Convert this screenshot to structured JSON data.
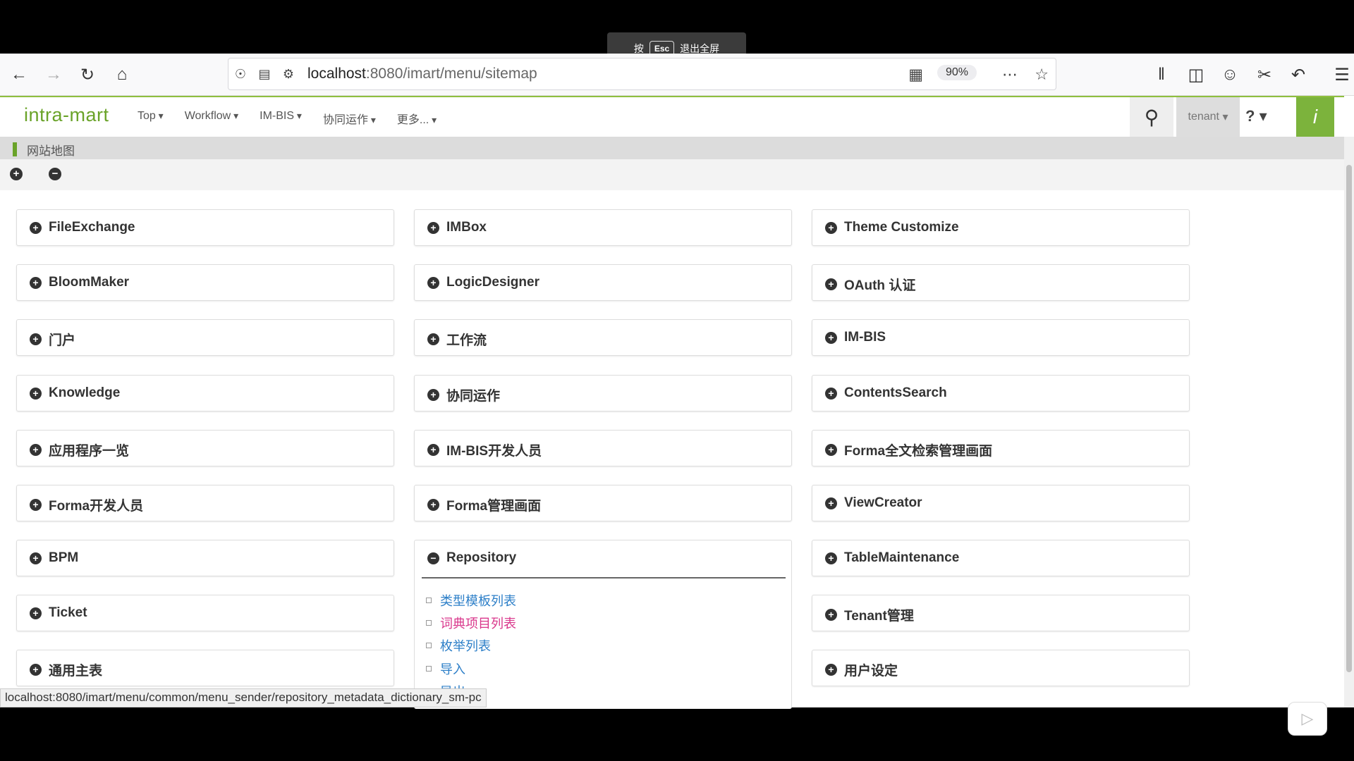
{
  "fullscreen_notice": {
    "press": "按",
    "key": "Esc",
    "exit": "退出全屏"
  },
  "browser": {
    "url_host": "localhost",
    "url_path": ":8080/imart/menu/sitemap",
    "zoom": "90%"
  },
  "app": {
    "logo": "intra-mart",
    "nav": [
      "Top",
      "Workflow",
      "IM-BIS",
      "协同运作",
      "更多..."
    ],
    "tenant": "tenant",
    "help": "?",
    "brand_icon": "i"
  },
  "breadcrumb": "网站地图",
  "actions": {
    "expand": "+",
    "collapse": "−"
  },
  "columns": [
    [
      "FileExchange",
      "BloomMaker",
      "门户",
      "Knowledge",
      "应用程序一览",
      "Forma开发人员",
      "BPM",
      "Ticket",
      "通用主表"
    ],
    [
      "IMBox",
      "LogicDesigner",
      "工作流",
      "协同运作",
      "IM-BIS开发人员",
      "Forma管理画面",
      "Repository"
    ],
    [
      "Theme Customize",
      "OAuth 认证",
      "IM-BIS",
      "ContentsSearch",
      "Forma全文检索管理画面",
      "ViewCreator",
      "TableMaintenance",
      "Tenant管理",
      "用户设定"
    ]
  ],
  "repository_items": [
    "类型模板列表",
    "词典项目列表",
    "枚举列表",
    "导入",
    "导出"
  ],
  "status_url": "localhost:8080/imart/menu/common/menu_sender/repository_metadata_dictionary_sm-pc",
  "colors": {
    "brand": "#7cb33c",
    "link": "#2d7fc8",
    "link_hover": "#d9368b"
  }
}
